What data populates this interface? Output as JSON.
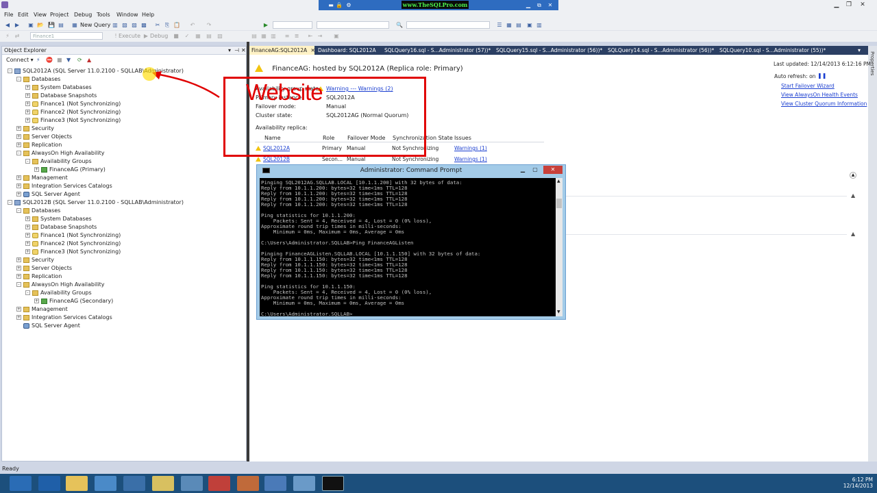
{
  "window": {
    "brand_text": "www.TheSQLPro.com"
  },
  "menu": [
    "File",
    "Edit",
    "View",
    "Project",
    "Debug",
    "Tools",
    "Window",
    "Help"
  ],
  "toolbar": {
    "new_query_label": "New Query",
    "database_dropdown": "Finance1",
    "execute_label": "Execute",
    "debug_label": "Debug"
  },
  "object_explorer": {
    "title": "Object Explorer",
    "connect_label": "Connect ▾",
    "tree": [
      {
        "label": "SQL2012A (SQL Server 11.0.2100 - SQLLAB\\Administrator)",
        "level": 0,
        "icon": "server-icon",
        "exp": "-"
      },
      {
        "label": "Databases",
        "level": 1,
        "icon": "folder-icon",
        "exp": "-"
      },
      {
        "label": "System Databases",
        "level": 2,
        "icon": "folder-icon",
        "exp": "+"
      },
      {
        "label": "Database Snapshots",
        "level": 2,
        "icon": "folder-icon",
        "exp": "+"
      },
      {
        "label": "Finance1 (Not Synchronizing)",
        "level": 2,
        "icon": "database-icon",
        "exp": "+"
      },
      {
        "label": "Finance2 (Not Synchronizing)",
        "level": 2,
        "icon": "database-icon",
        "exp": "+"
      },
      {
        "label": "Finance3 (Not Synchronizing)",
        "level": 2,
        "icon": "database-icon",
        "exp": "+"
      },
      {
        "label": "Security",
        "level": 1,
        "icon": "folder-icon",
        "exp": "+"
      },
      {
        "label": "Server Objects",
        "level": 1,
        "icon": "folder-icon",
        "exp": "+"
      },
      {
        "label": "Replication",
        "level": 1,
        "icon": "folder-icon",
        "exp": "+"
      },
      {
        "label": "AlwaysOn High Availability",
        "level": 1,
        "icon": "folder-icon",
        "exp": "-"
      },
      {
        "label": "Availability Groups",
        "level": 2,
        "icon": "folder-icon",
        "exp": "-"
      },
      {
        "label": "FinanceAG (Primary)",
        "level": 3,
        "icon": "availability-group-icon",
        "exp": "+"
      },
      {
        "label": "Management",
        "level": 1,
        "icon": "folder-icon",
        "exp": "+"
      },
      {
        "label": "Integration Services Catalogs",
        "level": 1,
        "icon": "folder-icon",
        "exp": "+"
      },
      {
        "label": "SQL Server Agent",
        "level": 1,
        "icon": "agent-icon",
        "exp": "+"
      },
      {
        "label": "SQL2012B (SQL Server 11.0.2100 - SQLLAB\\Administrator)",
        "level": 0,
        "icon": "server-icon",
        "exp": "-"
      },
      {
        "label": "Databases",
        "level": 1,
        "icon": "folder-icon",
        "exp": "-"
      },
      {
        "label": "System Databases",
        "level": 2,
        "icon": "folder-icon",
        "exp": "+"
      },
      {
        "label": "Database Snapshots",
        "level": 2,
        "icon": "folder-icon",
        "exp": "+"
      },
      {
        "label": "Finance1 (Not Synchronizing)",
        "level": 2,
        "icon": "database-icon",
        "exp": "+"
      },
      {
        "label": "Finance2 (Not Synchronizing)",
        "level": 2,
        "icon": "database-icon",
        "exp": "+"
      },
      {
        "label": "Finance3 (Not Synchronizing)",
        "level": 2,
        "icon": "database-icon",
        "exp": "+"
      },
      {
        "label": "Security",
        "level": 1,
        "icon": "folder-icon",
        "exp": "+"
      },
      {
        "label": "Server Objects",
        "level": 1,
        "icon": "folder-icon",
        "exp": "+"
      },
      {
        "label": "Replication",
        "level": 1,
        "icon": "folder-icon",
        "exp": "+"
      },
      {
        "label": "AlwaysOn High Availability",
        "level": 1,
        "icon": "folder-icon",
        "exp": "-"
      },
      {
        "label": "Availability Groups",
        "level": 2,
        "icon": "folder-icon",
        "exp": "-"
      },
      {
        "label": "FinanceAG (Secondary)",
        "level": 3,
        "icon": "availability-group-icon",
        "exp": "+"
      },
      {
        "label": "Management",
        "level": 1,
        "icon": "folder-icon",
        "exp": "+"
      },
      {
        "label": "Integration Services Catalogs",
        "level": 1,
        "icon": "folder-icon",
        "exp": "+"
      },
      {
        "label": "SQL Server Agent",
        "level": 1,
        "icon": "agent-icon",
        "exp": ""
      }
    ]
  },
  "doc_tabs": [
    {
      "label": "FinanceAG:SQL2012A",
      "active": true
    },
    {
      "label": "Dashboard: SQL2012A",
      "active": false
    },
    {
      "label": "SQLQuery16.sql - S...Administrator (57))*",
      "active": false
    },
    {
      "label": "SQLQuery15.sql - S...Administrator (56))*",
      "active": false
    },
    {
      "label": "SQLQuery14.sql - S...Administrator (56))*",
      "active": false
    },
    {
      "label": "SQLQuery10.sql - S...Administrator (55))*",
      "active": false
    }
  ],
  "dashboard": {
    "header": "FinanceAG: hosted by SQL2012A (Replica role: Primary)",
    "last_updated": "Last updated: 12/14/2013 6:12:16 PM",
    "auto_refresh": "Auto refresh: on",
    "links": [
      "Start Failover Wizard",
      "View AlwaysOn Health Events",
      "View Cluster Quorum Information"
    ],
    "fields": [
      {
        "label": "Availability group state:",
        "value": "Warning --- Warnings (2)",
        "link": true
      },
      {
        "label": "Primary instance:",
        "value": "SQL2012A",
        "link": false
      },
      {
        "label": "Failover mode:",
        "value": "Manual",
        "link": false
      },
      {
        "label": "Cluster state:",
        "value": "SQL2012AG (Normal Quorum)",
        "link": false
      }
    ],
    "replica_label": "Availability replica:",
    "replica_columns": [
      "Name",
      "Role",
      "Failover Mode",
      "Synchronization State",
      "Issues"
    ],
    "replicas": [
      {
        "name": "SQL2012A",
        "role": "Primary",
        "failover": "Manual",
        "sync": "Not Synchronizing",
        "issues": "Warnings (1)"
      },
      {
        "name": "SQL2012B",
        "role": "Secon...",
        "failover": "Manual",
        "sync": "Not Synchronizing",
        "issues": "Warnings (1)"
      }
    ]
  },
  "annotation": {
    "text": "Website"
  },
  "cmd": {
    "title": "Administrator: Command Prompt",
    "output": "Pinging SQL2012AG.SQLLAB.LOCAL [10.1.1.200] with 32 bytes of data:\nReply from 10.1.1.200: bytes=32 time<1ms TTL=128\nReply from 10.1.1.200: bytes=32 time<1ms TTL=128\nReply from 10.1.1.200: bytes=32 time<1ms TTL=128\nReply from 10.1.1.200: bytes=32 time<1ms TTL=128\n\nPing statistics for 10.1.1.200:\n    Packets: Sent = 4, Received = 4, Lost = 0 (0% loss),\nApproximate round trip times in milli-seconds:\n    Minimum = 0ms, Maximum = 0ms, Average = 0ms\n\nC:\\Users\\Administrator.SQLLAB>Ping FinanceAGListen\n\nPinging FinanceAGListen.SQLLAB.LOCAL [10.1.1.150] with 32 bytes of data:\nReply from 10.1.1.150: bytes=32 time<1ms TTL=128\nReply from 10.1.1.150: bytes=32 time<1ms TTL=128\nReply from 10.1.1.150: bytes=32 time<1ms TTL=128\nReply from 10.1.1.150: bytes=32 time<1ms TTL=128\n\nPing statistics for 10.1.1.150:\n    Packets: Sent = 4, Received = 4, Lost = 0 (0% loss),\nApproximate round trip times in milli-seconds:\n    Minimum = 0ms, Maximum = 0ms, Average = 0ms\n\nC:\\Users\\Administrator.SQLLAB>_"
  },
  "status": {
    "text": "Ready"
  },
  "tray": {
    "time": "6:12 PM",
    "date": "12/14/2013"
  },
  "colors": {
    "accent": "#2e6cc0",
    "annotation_red": "#e00000",
    "warning": "#f2c40f",
    "taskbar": "#1c4f7c"
  }
}
